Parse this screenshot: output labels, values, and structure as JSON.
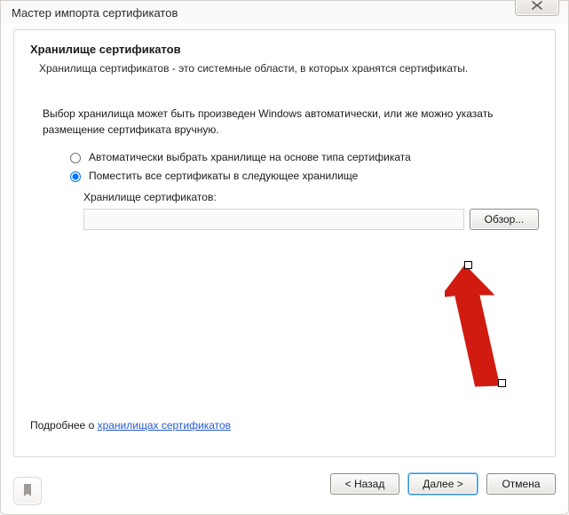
{
  "window": {
    "title": "Мастер импорта сертификатов"
  },
  "section": {
    "title": "Хранилище сертификатов",
    "desc": "Хранилища сертификатов - это системные области, в которых хранятся сертификаты."
  },
  "body": {
    "lead": "Выбор хранилища может быть произведен Windows автоматически, или же можно указать размещение сертификата вручную."
  },
  "options": {
    "auto": "Автоматически выбрать хранилище на основе типа сертификата",
    "manual": "Поместить все сертификаты в следующее хранилище"
  },
  "store": {
    "label": "Хранилище сертификатов:",
    "value": "",
    "browse": "Обзор..."
  },
  "more": {
    "prefix": "Подробнее о ",
    "link_text": "хранилищах сертификатов"
  },
  "buttons": {
    "back": "< Назад",
    "next": "Далее >",
    "cancel": "Отмена"
  }
}
